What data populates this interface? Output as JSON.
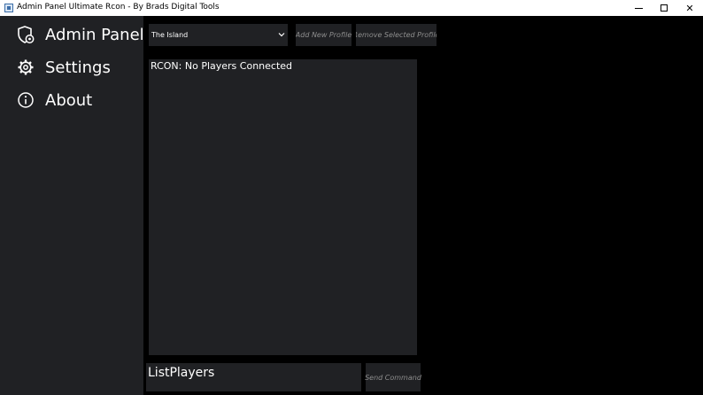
{
  "window": {
    "title": "Admin Panel Ultimate Rcon - By Brads Digital Tools",
    "icon": "app-window-icon",
    "controls": {
      "minimize": "minimize-icon",
      "maximize": "maximize-icon",
      "close": "✕"
    }
  },
  "sidebar": {
    "background": "#202124",
    "items": [
      {
        "label": "Admin Panel",
        "icon": "shield-icon"
      },
      {
        "label": "Settings",
        "icon": "gear-icon"
      },
      {
        "label": "About",
        "icon": "info-icon"
      }
    ]
  },
  "toolbar": {
    "profile_selected": "The Island",
    "add_profile_label": "Add New Profile",
    "remove_profile_label": "Remove Selected Profile"
  },
  "console": {
    "output": "RCON: No Players Connected"
  },
  "command": {
    "value": "ListPlayers",
    "send_label": "Send Command"
  },
  "colors": {
    "background": "#000000",
    "panel": "#202124",
    "text": "#ffffff",
    "muted_text": "#8d8d8d"
  }
}
